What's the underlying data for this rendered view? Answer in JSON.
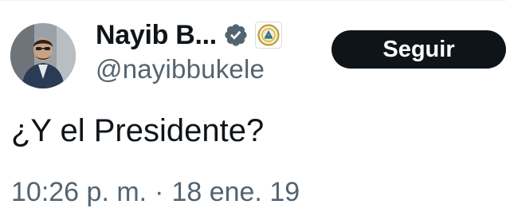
{
  "tweet": {
    "author": {
      "display_name": "Nayib B...",
      "handle": "@nayibbukele",
      "verified_icon": "verified-badge-icon",
      "affiliation_icon": "el-salvador-seal-icon",
      "verified_color": "#536471"
    },
    "follow_label": "Seguir",
    "text": "¿Y el Presidente?",
    "time": "10:26 p. m.",
    "separator": "·",
    "date": "18 ene. 19"
  },
  "colors": {
    "text_primary": "#0f1419",
    "text_secondary": "#536471",
    "button_bg": "#0f1419",
    "button_text": "#ffffff"
  }
}
